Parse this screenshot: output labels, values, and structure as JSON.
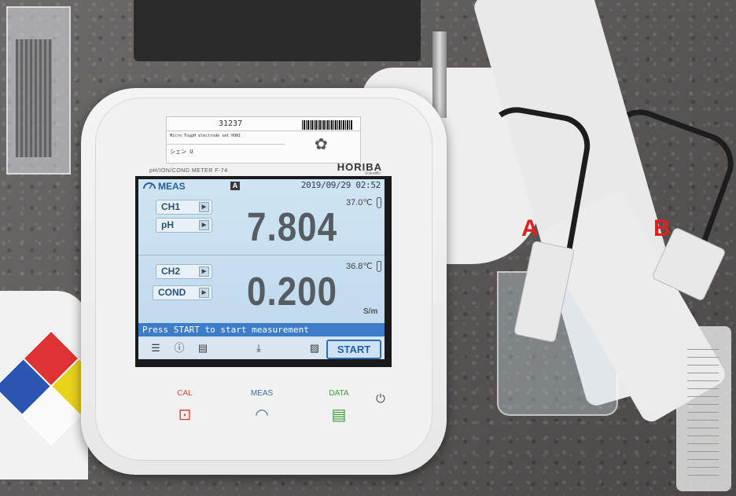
{
  "scene": {
    "markers": {
      "a": "A",
      "b": "B"
    }
  },
  "meter": {
    "sticker": {
      "id": "31237",
      "line1": "Micro ToupH electrode set HORI",
      "line2": "シェン U"
    },
    "model": "pH/ION/COND METER F-74",
    "brand": "HORIBA",
    "brand_sub": "Scientific",
    "display": {
      "mode": "MEAS",
      "badge": "A",
      "datetime": "2019/09/29 02:52",
      "channels": [
        {
          "channel": "CH1",
          "param": "pH",
          "temp": "37.0℃",
          "value": "7.804",
          "unit": ""
        },
        {
          "channel": "CH2",
          "param": "COND",
          "temp": "36.8℃",
          "value": "0.200",
          "unit": "S/m"
        }
      ],
      "status": "Press START to start measurement",
      "start_label": "START",
      "toolbar_icons": [
        "list-icon",
        "info-icon",
        "book-icon",
        "download-icon",
        "graph-icon"
      ]
    },
    "keys": [
      {
        "label": "CAL",
        "color": "#d9453f"
      },
      {
        "label": "MEAS",
        "color": "#3d6fa8"
      },
      {
        "label": "DATA",
        "color": "#3f9a3c"
      }
    ],
    "power_icon": "power-icon"
  }
}
